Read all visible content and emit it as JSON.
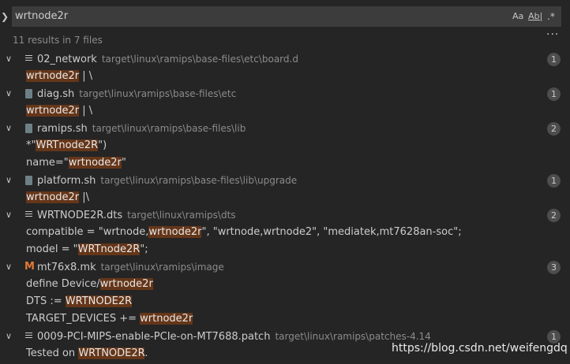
{
  "search": {
    "query": "wrtnode2r",
    "options": {
      "match_case": "Aa",
      "whole_word": "Ab|",
      "regex": ".*"
    }
  },
  "summary": "11 results in 7 files",
  "more_actions": "···",
  "files": [
    {
      "name": "02_network",
      "path": "target\\linux\\ramips\\base-files\\etc\\board.d",
      "count": "1",
      "icon": "lines-file-icon",
      "matches": [
        {
          "before": "",
          "match": "wrtnode2r",
          "after": " | \\"
        }
      ]
    },
    {
      "name": "diag.sh",
      "path": "target\\linux\\ramips\\base-files\\etc",
      "count": "1",
      "icon": "shell-file-icon",
      "matches": [
        {
          "before": "",
          "match": "wrtnode2r",
          "after": " | \\"
        }
      ]
    },
    {
      "name": "ramips.sh",
      "path": "target\\linux\\ramips\\base-files\\lib",
      "count": "2",
      "icon": "shell-file-icon",
      "matches": [
        {
          "before": "*\"",
          "match": "WRTnode2R",
          "after": "\")"
        },
        {
          "before": "name=\"",
          "match": "wrtnode2r",
          "after": "\""
        }
      ]
    },
    {
      "name": "platform.sh",
      "path": "target\\linux\\ramips\\base-files\\lib\\upgrade",
      "count": "1",
      "icon": "shell-file-icon",
      "matches": [
        {
          "before": "",
          "match": "wrtnode2r",
          "after": " |\\"
        }
      ]
    },
    {
      "name": "WRTNODE2R.dts",
      "path": "target\\linux\\ramips\\dts",
      "count": "2",
      "icon": "lines-file-icon",
      "matches": [
        {
          "before": "compatible = \"wrtnode,",
          "match": "wrtnode2r",
          "after": "\", \"wrtnode,wrtnode2\", \"mediatek,mt7628an-soc\";"
        },
        {
          "before": "model = \"",
          "match": "WRTnode2R",
          "after": "\";"
        }
      ]
    },
    {
      "name": "mt76x8.mk",
      "path": "target\\linux\\ramips\\image",
      "count": "3",
      "icon": "makefile-icon",
      "matches": [
        {
          "before": "define Device/",
          "match": "wrtnode2r",
          "after": ""
        },
        {
          "before": "DTS := ",
          "match": "WRTNODE2R",
          "after": ""
        },
        {
          "before": "TARGET_DEVICES += ",
          "match": "wrtnode2r",
          "after": ""
        }
      ]
    },
    {
      "name": "0009-PCI-MIPS-enable-PCIe-on-MT7688.patch",
      "path": "target\\linux\\ramips\\patches-4.14",
      "count": "1",
      "icon": "lines-file-icon",
      "matches": [
        {
          "before": "Tested on ",
          "match": "WRTNODE2R",
          "after": "."
        }
      ]
    }
  ],
  "watermark": "https://blog.csdn.net/weifengdq"
}
